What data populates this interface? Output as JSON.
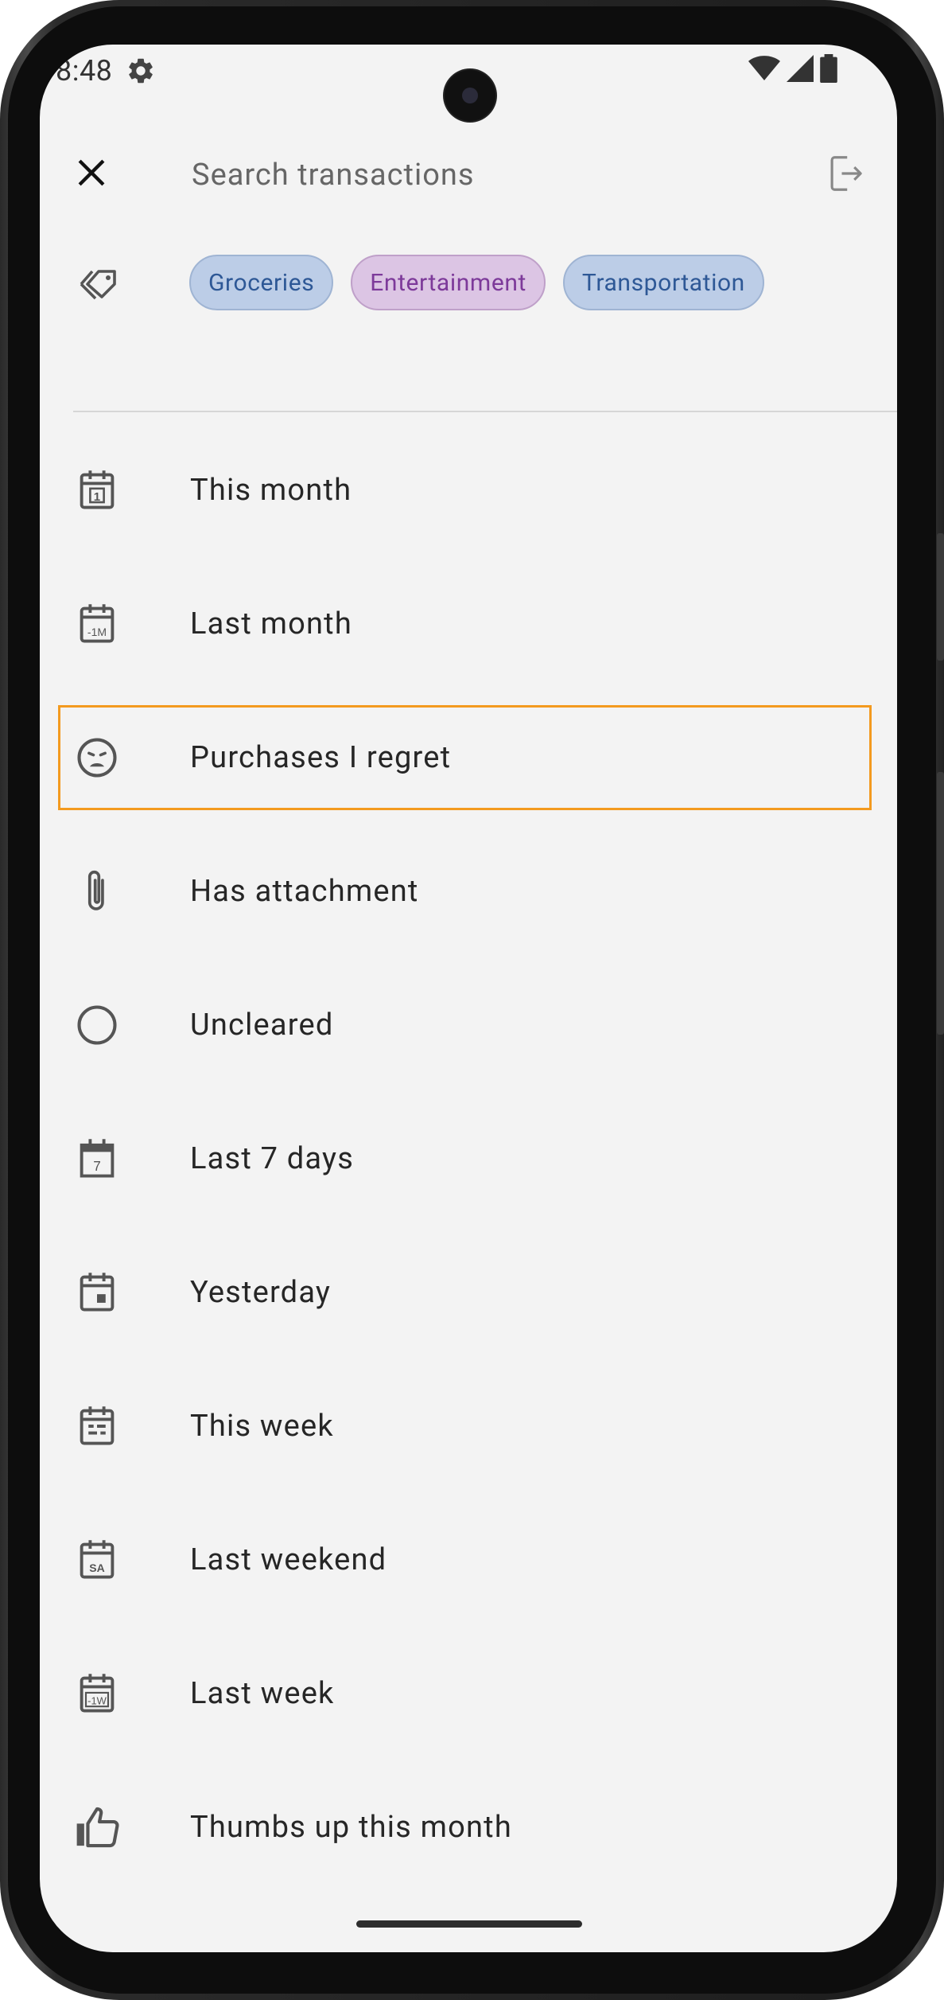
{
  "status_bar": {
    "time": "8:48",
    "settings_icon": "gear-icon",
    "wifi_icon": "wifi-icon",
    "signal_icon": "signal-icon",
    "battery_icon": "battery-icon"
  },
  "search": {
    "placeholder": "Search transactions",
    "close_icon": "close-icon",
    "exit_icon": "exit-icon"
  },
  "tags": {
    "icon": "tags-icon",
    "chips": [
      {
        "label": "Groceries",
        "color": "#2e5896"
      },
      {
        "label": "Entertainment",
        "color": "#7d3a9a"
      },
      {
        "label": "Transportation",
        "color": "#2e5896"
      }
    ]
  },
  "filters": [
    {
      "label": "This month",
      "icon": "calendar-1-icon"
    },
    {
      "label": "Last month",
      "icon": "calendar-minus-1m-icon"
    },
    {
      "label": "Purchases I regret",
      "icon": "sad-face-icon",
      "highlighted": true
    },
    {
      "label": "Has attachment",
      "icon": "paperclip-icon"
    },
    {
      "label": "Uncleared",
      "icon": "circle-icon"
    },
    {
      "label": "Last 7 days",
      "icon": "calendar-7-icon"
    },
    {
      "label": "Yesterday",
      "icon": "calendar-day-icon"
    },
    {
      "label": "This week",
      "icon": "calendar-week-icon"
    },
    {
      "label": "Last weekend",
      "icon": "calendar-sa-icon"
    },
    {
      "label": "Last week",
      "icon": "calendar-minus-1w-icon"
    },
    {
      "label": "Thumbs up this month",
      "icon": "thumbs-up-icon"
    }
  ],
  "colors": {
    "highlight_border": "#f39a1f",
    "background": "#f3f3f3",
    "chip_blue_bg": "#bccde7",
    "chip_purple_bg": "#dcc5e4"
  }
}
